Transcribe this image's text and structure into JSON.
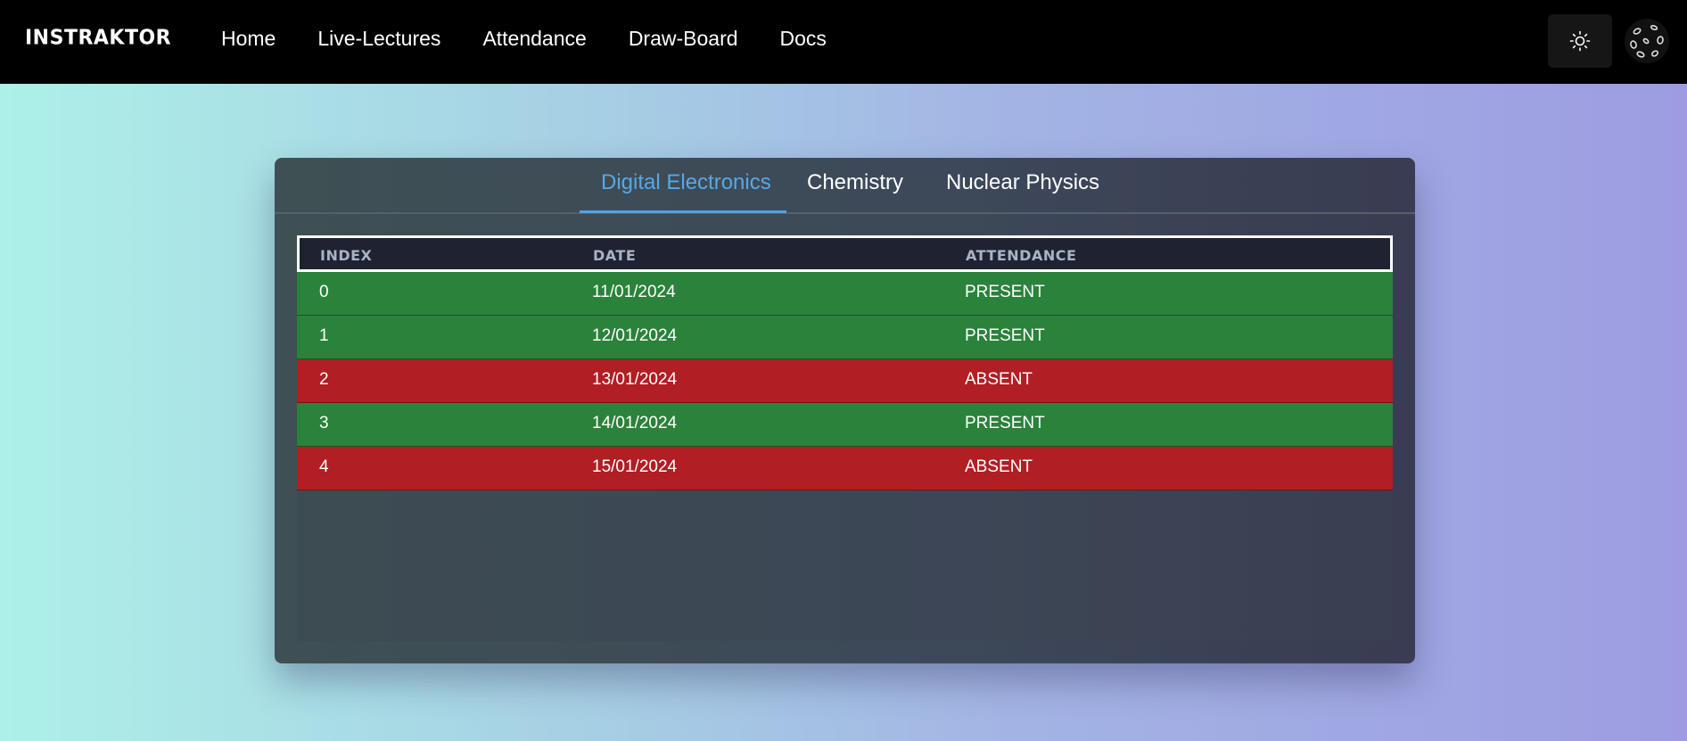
{
  "brand": {
    "logo_text": "INSTRAKTOR"
  },
  "nav": {
    "links": [
      "Home",
      "Live-Lectures",
      "Attendance",
      "Draw-Board",
      "Docs"
    ]
  },
  "header_icons": {
    "theme_toggle": "sun-icon",
    "avatar": "avatar-icon"
  },
  "tabs": [
    {
      "label": "Digital Electronics",
      "active": true
    },
    {
      "label": "Chemistry",
      "active": false
    },
    {
      "label": "Nuclear Physics",
      "active": false
    }
  ],
  "table": {
    "columns": [
      "INDEX",
      "DATE",
      "ATTENDANCE"
    ],
    "rows": [
      {
        "index": "0",
        "date": "11/01/2024",
        "attendance": "PRESENT"
      },
      {
        "index": "1",
        "date": "12/01/2024",
        "attendance": "PRESENT"
      },
      {
        "index": "2",
        "date": "13/01/2024",
        "attendance": "ABSENT"
      },
      {
        "index": "3",
        "date": "14/01/2024",
        "attendance": "PRESENT"
      },
      {
        "index": "4",
        "date": "15/01/2024",
        "attendance": "ABSENT"
      }
    ]
  },
  "colors": {
    "present": "#2b823b",
    "absent": "#b11e23",
    "active_tab": "#55a9e8",
    "navbar": "#000000"
  }
}
